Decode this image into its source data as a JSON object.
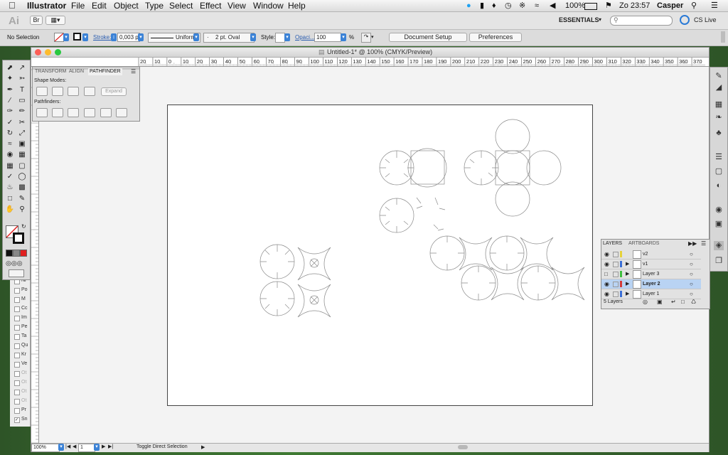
{
  "menubar": {
    "app": "Illustrator",
    "items": [
      "File",
      "Edit",
      "Object",
      "Type",
      "Select",
      "Effect",
      "View",
      "Window",
      "Help"
    ],
    "battery": "100%",
    "clock": "Zo 23:57",
    "user": "Casper"
  },
  "appbar": {
    "ai_label": "Ai",
    "br_label": "Br",
    "workspace": "ESSENTIALS",
    "search_placeholder": "",
    "cslive": "CS Live"
  },
  "control": {
    "selection": "No Selection",
    "stroke_label": "Stroke:",
    "stroke_value": "0,003 p",
    "profile": "Uniform",
    "brush": "2 pt. Oval",
    "style_label": "Style:",
    "opacity_label": "Opaci...",
    "opacity_value": "100",
    "percent": "%",
    "doc_setup": "Document Setup",
    "preferences": "Preferences"
  },
  "document": {
    "title": "Untitled-1* @ 100% (CMYK/Preview)",
    "ruler_ticks": [
      "20",
      "10",
      "0",
      "10",
      "20",
      "30",
      "40",
      "50",
      "60",
      "70",
      "80",
      "90",
      "100",
      "110",
      "120",
      "130",
      "140",
      "150",
      "160",
      "170",
      "180",
      "190",
      "200",
      "210",
      "220",
      "230",
      "240",
      "250",
      "260",
      "270",
      "280",
      "290",
      "300",
      "310",
      "320",
      "330",
      "340",
      "350",
      "360",
      "370"
    ],
    "zoom": "100%",
    "artboard_num": "1",
    "status": "Toggle Direct Selection"
  },
  "pathfinder": {
    "tabs": [
      "TRANSFORM",
      "ALIGN",
      "PATHFINDER"
    ],
    "shape_modes": "Shape Modes:",
    "expand": "Expand",
    "pathfinders": "Pathfinders:"
  },
  "layers_panel": {
    "tabs": [
      "LAYERS",
      "ARTBOARDS"
    ],
    "layers": [
      {
        "name": "v2",
        "color": "#e6d23a"
      },
      {
        "name": "v1",
        "color": "#3b6fd6"
      },
      {
        "name": "Layer 3",
        "color": "#3fbf3f"
      },
      {
        "name": "Layer 2",
        "color": "#d43b3b"
      },
      {
        "name": "Layer 1",
        "color": "#3b6fd6"
      }
    ],
    "count": "5 Layers"
  },
  "left_sliver": {
    "items": [
      "Ni",
      "Po",
      "M",
      "Cc",
      "Im",
      "Pe",
      "Ta",
      "Qu",
      "Kr",
      "Ve",
      "Ot",
      "Ot",
      "Ot",
      "Ot",
      "Pr",
      "Sn"
    ]
  },
  "colors": {
    "accent": "#3b82d6",
    "selected_row": "#b9d3f3"
  }
}
